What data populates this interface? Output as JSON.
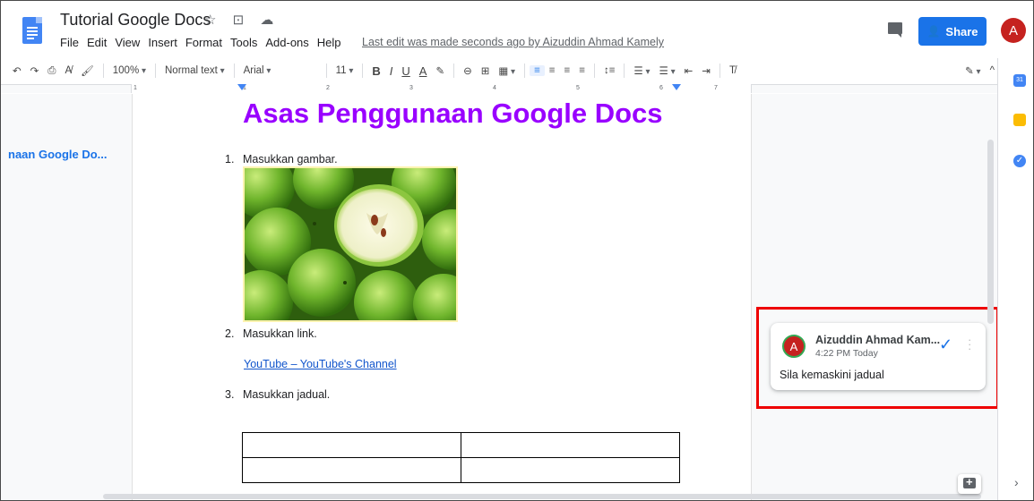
{
  "app": {
    "doc_title": "Tutorial Google Docs",
    "title_icons": "☆ ⊡ ☁",
    "menu": [
      "File",
      "Edit",
      "View",
      "Insert",
      "Format",
      "Tools",
      "Add-ons",
      "Help"
    ],
    "last_edit": "Last edit was made seconds ago by Aizuddin Ahmad Kamely",
    "share_label": "Share",
    "avatar_initial": "A"
  },
  "toolbar": {
    "undo": "↶",
    "redo": "↷",
    "print": "⎙",
    "spell": "A̸",
    "paint": "🖌",
    "zoom": "100%",
    "style": "Normal text",
    "font": "Arial",
    "font_size": "11",
    "bold": "B",
    "italic": "I",
    "underline": "U",
    "text_color": "A",
    "highlight": "✎",
    "link": "⊖",
    "comment": "⊞",
    "image": "▦",
    "align_left": "≡",
    "align_center": "≡",
    "align_right": "≡",
    "align_justify": "≡",
    "line_spacing": "↕≡",
    "checklist": "☰",
    "bullets": "☰",
    "numbered": "☰",
    "indent_less": "⇤",
    "indent_more": "⇥",
    "clear": "T̸",
    "editing": "✎",
    "collapse": "^"
  },
  "ruler": {
    "numbers": [
      "1",
      "1",
      "2",
      "3",
      "4",
      "5",
      "6",
      "7"
    ]
  },
  "outline": {
    "item": "naan Google Do..."
  },
  "document": {
    "heading": "Asas Penggunaan Google Docs",
    "items": [
      {
        "num": "1.",
        "text": "Masukkan gambar."
      },
      {
        "num": "2.",
        "text": "Masukkan link."
      },
      {
        "num": "3.",
        "text": "Masukkan jadual."
      }
    ],
    "link": "YouTube – YouTube's Channel"
  },
  "comment": {
    "initial": "A",
    "author": "Aizuddin Ahmad Kam...",
    "time": "4:22 PM Today",
    "body": "Sila kemaskini jadual",
    "resolve": "✓",
    "more": "⋮"
  },
  "side_panel": {
    "calendar": "31",
    "tasks": "✓",
    "expand": "›"
  },
  "colors": {
    "heading": "#9900ff",
    "accent": "#1a73e8",
    "highlight_box": "#e00000"
  }
}
